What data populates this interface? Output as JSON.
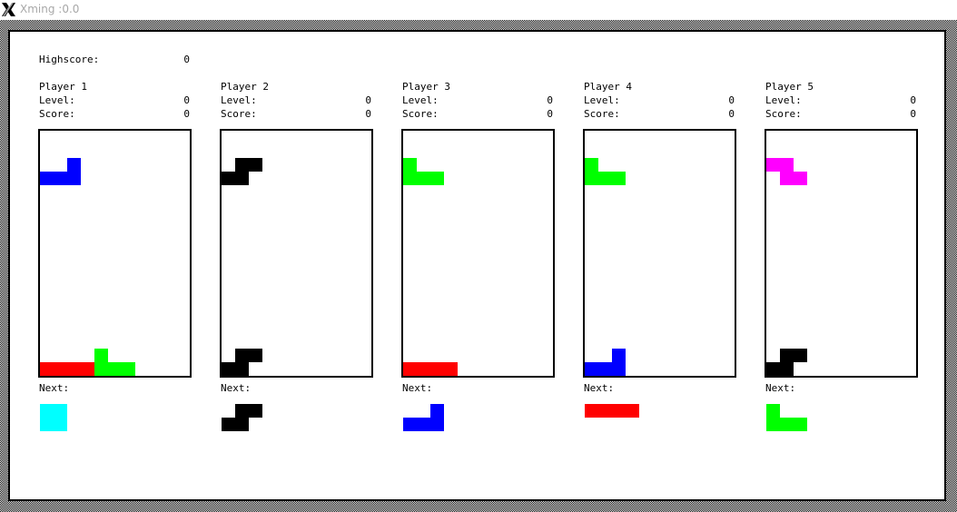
{
  "window": {
    "title": "Xming :0.0",
    "icon": "x-logo-icon"
  },
  "highscore": {
    "label": "Highscore:",
    "value": "0"
  },
  "labels": {
    "level": "Level:",
    "score": "Score:",
    "next": "Next:"
  },
  "colors": {
    "blue": "#0000ff",
    "black": "#000000",
    "green": "#00ff00",
    "red": "#ff0000",
    "magenta": "#ff00ff",
    "cyan": "#00ffff"
  },
  "players": [
    {
      "name": "Player 1",
      "level": "0",
      "score": "0",
      "board_cells": [
        {
          "col": 2,
          "row": 2,
          "color": "blue"
        },
        {
          "col": 0,
          "row": 3,
          "color": "blue"
        },
        {
          "col": 1,
          "row": 3,
          "color": "blue"
        },
        {
          "col": 2,
          "row": 3,
          "color": "blue"
        },
        {
          "col": 4,
          "row": 16,
          "color": "green"
        },
        {
          "col": 0,
          "row": 17,
          "color": "red"
        },
        {
          "col": 1,
          "row": 17,
          "color": "red"
        },
        {
          "col": 2,
          "row": 17,
          "color": "red"
        },
        {
          "col": 3,
          "row": 17,
          "color": "red"
        },
        {
          "col": 4,
          "row": 17,
          "color": "green"
        },
        {
          "col": 5,
          "row": 17,
          "color": "green"
        },
        {
          "col": 6,
          "row": 17,
          "color": "green"
        }
      ],
      "next_cells": [
        {
          "col": 0,
          "row": 0,
          "color": "cyan"
        },
        {
          "col": 1,
          "row": 0,
          "color": "cyan"
        },
        {
          "col": 0,
          "row": 1,
          "color": "cyan"
        },
        {
          "col": 1,
          "row": 1,
          "color": "cyan"
        }
      ]
    },
    {
      "name": "Player 2",
      "level": "0",
      "score": "0",
      "board_cells": [
        {
          "col": 1,
          "row": 2,
          "color": "black"
        },
        {
          "col": 2,
          "row": 2,
          "color": "black"
        },
        {
          "col": 0,
          "row": 3,
          "color": "black"
        },
        {
          "col": 1,
          "row": 3,
          "color": "black"
        },
        {
          "col": 1,
          "row": 16,
          "color": "black"
        },
        {
          "col": 2,
          "row": 16,
          "color": "black"
        },
        {
          "col": 0,
          "row": 17,
          "color": "black"
        },
        {
          "col": 1,
          "row": 17,
          "color": "black"
        }
      ],
      "next_cells": [
        {
          "col": 1,
          "row": 0,
          "color": "black"
        },
        {
          "col": 2,
          "row": 0,
          "color": "black"
        },
        {
          "col": 0,
          "row": 1,
          "color": "black"
        },
        {
          "col": 1,
          "row": 1,
          "color": "black"
        }
      ]
    },
    {
      "name": "Player 3",
      "level": "0",
      "score": "0",
      "board_cells": [
        {
          "col": 0,
          "row": 2,
          "color": "green"
        },
        {
          "col": 0,
          "row": 3,
          "color": "green"
        },
        {
          "col": 1,
          "row": 3,
          "color": "green"
        },
        {
          "col": 2,
          "row": 3,
          "color": "green"
        },
        {
          "col": 0,
          "row": 17,
          "color": "red"
        },
        {
          "col": 1,
          "row": 17,
          "color": "red"
        },
        {
          "col": 2,
          "row": 17,
          "color": "red"
        },
        {
          "col": 3,
          "row": 17,
          "color": "red"
        }
      ],
      "next_cells": [
        {
          "col": 2,
          "row": 0,
          "color": "blue"
        },
        {
          "col": 0,
          "row": 1,
          "color": "blue"
        },
        {
          "col": 1,
          "row": 1,
          "color": "blue"
        },
        {
          "col": 2,
          "row": 1,
          "color": "blue"
        }
      ]
    },
    {
      "name": "Player 4",
      "level": "0",
      "score": "0",
      "board_cells": [
        {
          "col": 0,
          "row": 2,
          "color": "green"
        },
        {
          "col": 0,
          "row": 3,
          "color": "green"
        },
        {
          "col": 1,
          "row": 3,
          "color": "green"
        },
        {
          "col": 2,
          "row": 3,
          "color": "green"
        },
        {
          "col": 2,
          "row": 16,
          "color": "blue"
        },
        {
          "col": 0,
          "row": 17,
          "color": "blue"
        },
        {
          "col": 1,
          "row": 17,
          "color": "blue"
        },
        {
          "col": 2,
          "row": 17,
          "color": "blue"
        }
      ],
      "next_cells": [
        {
          "col": 0,
          "row": 0,
          "color": "red"
        },
        {
          "col": 1,
          "row": 0,
          "color": "red"
        },
        {
          "col": 2,
          "row": 0,
          "color": "red"
        },
        {
          "col": 3,
          "row": 0,
          "color": "red"
        }
      ]
    },
    {
      "name": "Player 5",
      "level": "0",
      "score": "0",
      "board_cells": [
        {
          "col": 0,
          "row": 2,
          "color": "magenta"
        },
        {
          "col": 1,
          "row": 2,
          "color": "magenta"
        },
        {
          "col": 1,
          "row": 3,
          "color": "magenta"
        },
        {
          "col": 2,
          "row": 3,
          "color": "magenta"
        },
        {
          "col": 1,
          "row": 16,
          "color": "black"
        },
        {
          "col": 2,
          "row": 16,
          "color": "black"
        },
        {
          "col": 0,
          "row": 17,
          "color": "black"
        },
        {
          "col": 1,
          "row": 17,
          "color": "black"
        }
      ],
      "next_cells": [
        {
          "col": 0,
          "row": 0,
          "color": "green"
        },
        {
          "col": 0,
          "row": 1,
          "color": "green"
        },
        {
          "col": 1,
          "row": 1,
          "color": "green"
        },
        {
          "col": 2,
          "row": 1,
          "color": "green"
        }
      ]
    }
  ]
}
